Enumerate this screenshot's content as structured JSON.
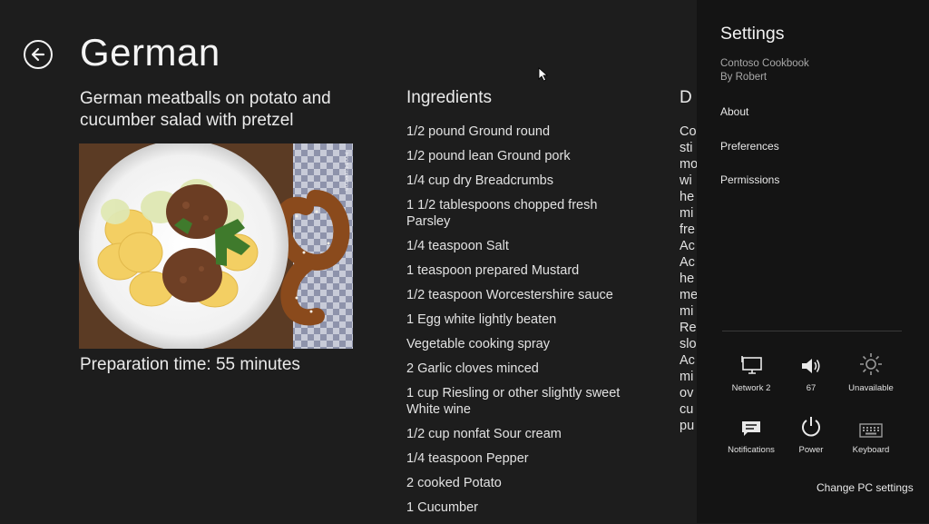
{
  "page": {
    "title": "German"
  },
  "recipe": {
    "subtitle": "German meatballs on potato and cucumber salad with pretzel",
    "image_alt": "German meatballs on potato and cucumber salad with pretzel",
    "prep_time": "Preparation time: 55 minutes"
  },
  "ingredients": {
    "heading": "Ingredients",
    "items": [
      "1/2 pound Ground round",
      "1/2 pound lean Ground pork",
      "1/4 cup dry Breadcrumbs",
      "1 1/2 tablespoons chopped fresh Parsley",
      "1/4 teaspoon Salt",
      "1 teaspoon prepared Mustard",
      "1/2 teaspoon Worcestershire sauce",
      "1 Egg white lightly beaten",
      "Vegetable cooking spray",
      "2 Garlic cloves minced",
      "1 cup Riesling or other slightly sweet White wine",
      "1/2 cup nonfat Sour cream",
      "1/4 teaspoon Pepper",
      "2 cooked Potato",
      "1 Cucumber"
    ]
  },
  "directions": {
    "heading": "D",
    "lines": [
      "Co",
      "sti",
      "mo",
      "wi",
      "he",
      "mi",
      "fre",
      "Ac",
      "Ac",
      "he",
      "me",
      "mi",
      "Re",
      "slo",
      "Ac",
      "mi",
      "ov",
      "cu",
      "pu"
    ]
  },
  "settings": {
    "title": "Settings",
    "app_name": "Contoso Cookbook",
    "app_author": "By Robert",
    "links": [
      "About",
      "Preferences",
      "Permissions"
    ],
    "quick_settings": [
      {
        "label": "Network  2",
        "icon": "network-icon"
      },
      {
        "label": "67",
        "icon": "volume-icon"
      },
      {
        "label": "Unavailable",
        "icon": "brightness-icon"
      },
      {
        "label": "Notifications",
        "icon": "notifications-icon"
      },
      {
        "label": "Power",
        "icon": "power-icon"
      },
      {
        "label": "Keyboard",
        "icon": "keyboard-icon"
      }
    ],
    "change_pc_settings": "Change PC settings"
  },
  "colors": {
    "background": "#1d1d1d",
    "settings_background": "#141414",
    "text": "#e8e8e8",
    "muted_text": "#a8a8a8"
  }
}
